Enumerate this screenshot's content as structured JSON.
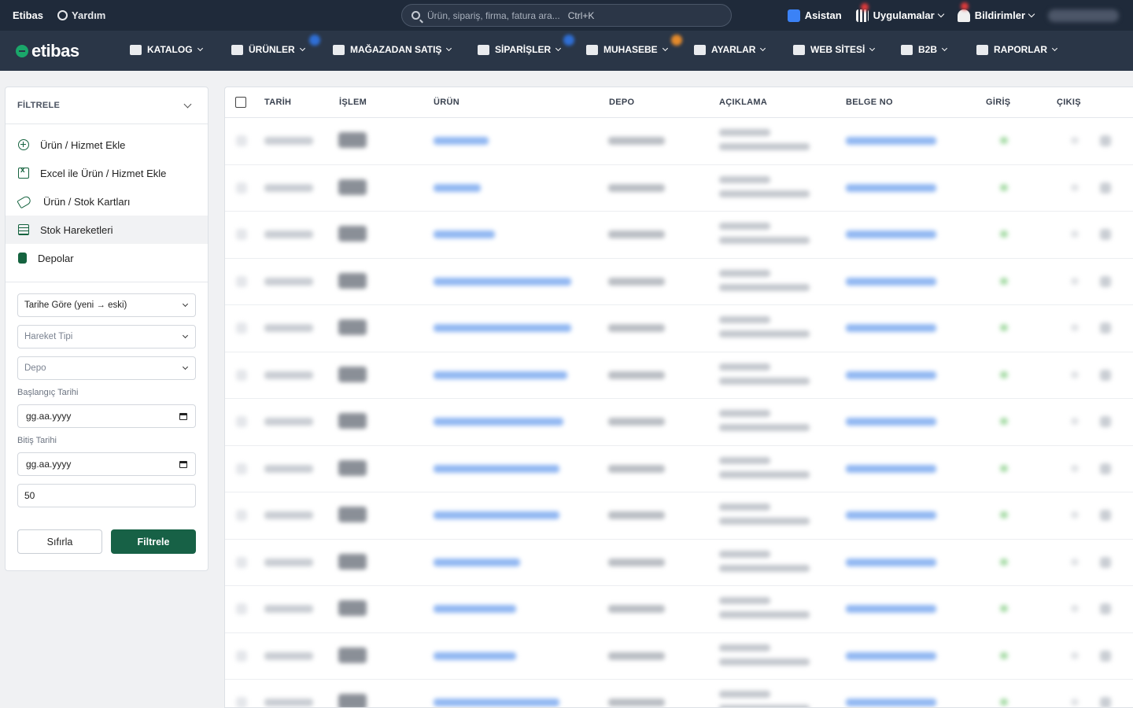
{
  "topbar": {
    "brand": "Etibas",
    "help_label": "Yardım",
    "search_placeholder": "Ürün, sipariş, firma, fatura ara...",
    "search_shortcut": "Ctrl+K",
    "assistant_label": "Asistan",
    "apps_label": "Uygulamalar",
    "notifications_label": "Bildirimler"
  },
  "nav": {
    "logo": "etibas",
    "items": [
      {
        "label": "KATALOG",
        "icon": "books-icon"
      },
      {
        "label": "ÜRÜNLER",
        "icon": "tag-icon"
      },
      {
        "label": "MAĞAZADAN SATIŞ",
        "icon": "cash-register-icon"
      },
      {
        "label": "SİPARİŞLER",
        "icon": "cart-icon"
      },
      {
        "label": "MUHASEBE",
        "icon": "calculator-icon"
      },
      {
        "label": "AYARLAR",
        "icon": "gear-icon"
      },
      {
        "label": "WEB SİTESİ",
        "icon": "globe-icon"
      },
      {
        "label": "B2B",
        "icon": "store-icon"
      },
      {
        "label": "RAPORLAR",
        "icon": "chart-icon"
      }
    ]
  },
  "sidebar": {
    "filter_title": "FİLTRELE",
    "menu": [
      {
        "label": "Ürün / Hizmet Ekle",
        "icon": "plus-circle-icon"
      },
      {
        "label": "Excel ile Ürün / Hizmet Ekle",
        "icon": "excel-icon"
      },
      {
        "label": "Ürün / Stok Kartları",
        "icon": "tags-icon"
      },
      {
        "label": "Stok Hareketleri",
        "icon": "sheet-icon"
      },
      {
        "label": "Depolar",
        "icon": "database-icon"
      }
    ],
    "sort_value": "Tarihe Göre (yeni → eski)",
    "movement_type_placeholder": "Hareket Tipi",
    "warehouse_placeholder": "Depo",
    "start_label": "Başlangıç Tarihi",
    "start_value": "gg.aa.yyyy",
    "end_label": "Bitiş Tarihi",
    "end_value": "gg.aa.yyyy",
    "limit_value": "50",
    "reset_label": "Sıfırla",
    "filter_label": "Filtrele"
  },
  "table": {
    "columns": [
      "TARİH",
      "İŞLEM",
      "ÜRÜN",
      "DEPO",
      "AÇIKLAMA",
      "BELGE NO",
      "GİRİŞ",
      "ÇIKIŞ"
    ],
    "row_count": 13
  },
  "colors": {
    "topbar": "#1f2a3a",
    "navbar": "#2a3647",
    "accent_green": "#176146",
    "link_blue": "#3b82f6"
  }
}
